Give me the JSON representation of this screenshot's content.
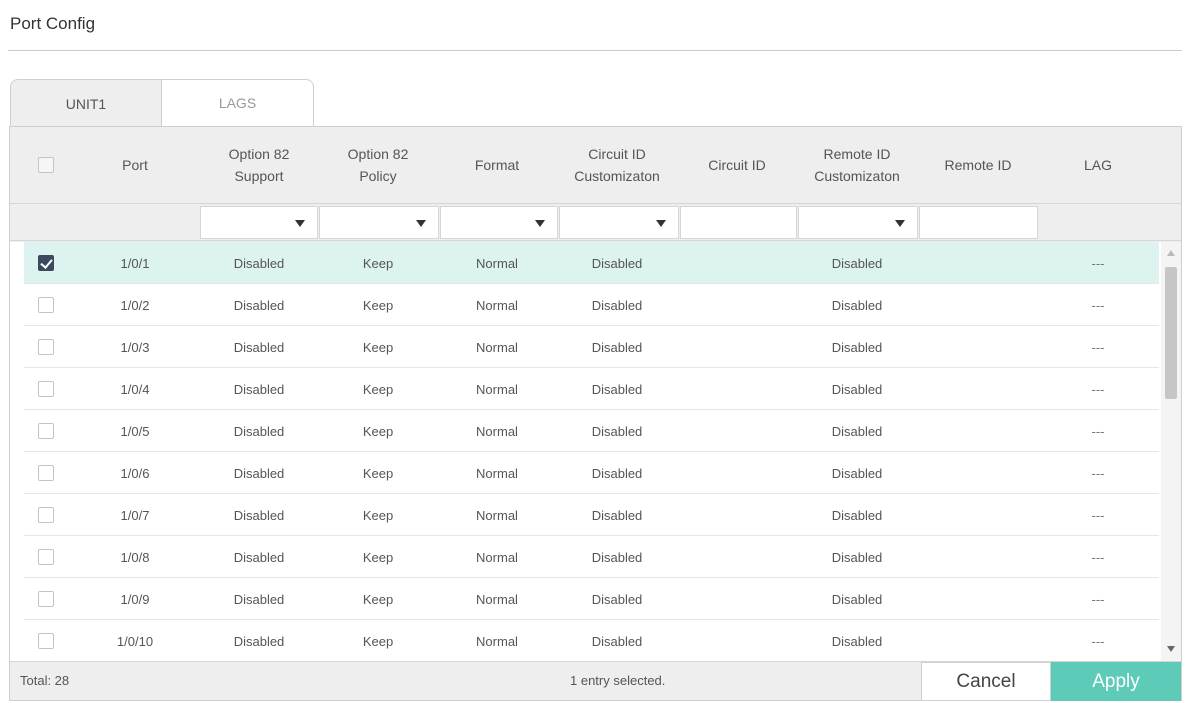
{
  "page": {
    "title": "Port Config"
  },
  "tabs": [
    {
      "label": "UNIT1",
      "active": true
    },
    {
      "label": "LAGS",
      "active": false
    }
  ],
  "columns": {
    "port": "Port",
    "opt82_support": [
      "Option 82",
      "Support"
    ],
    "opt82_policy": [
      "Option 82",
      "Policy"
    ],
    "format": "Format",
    "circuit_custom": [
      "Circuit ID",
      "Customizaton"
    ],
    "circuit_id": "Circuit ID",
    "remote_custom": [
      "Remote ID",
      "Customizaton"
    ],
    "remote_id": "Remote ID",
    "lag": "LAG"
  },
  "rows": [
    {
      "port": "1/0/1",
      "support": "Disabled",
      "policy": "Keep",
      "format": "Normal",
      "circuit_custom": "Disabled",
      "circuit_id": "",
      "remote_custom": "Disabled",
      "remote_id": "",
      "lag": "---",
      "checked": true
    },
    {
      "port": "1/0/2",
      "support": "Disabled",
      "policy": "Keep",
      "format": "Normal",
      "circuit_custom": "Disabled",
      "circuit_id": "",
      "remote_custom": "Disabled",
      "remote_id": "",
      "lag": "---",
      "checked": false
    },
    {
      "port": "1/0/3",
      "support": "Disabled",
      "policy": "Keep",
      "format": "Normal",
      "circuit_custom": "Disabled",
      "circuit_id": "",
      "remote_custom": "Disabled",
      "remote_id": "",
      "lag": "---",
      "checked": false
    },
    {
      "port": "1/0/4",
      "support": "Disabled",
      "policy": "Keep",
      "format": "Normal",
      "circuit_custom": "Disabled",
      "circuit_id": "",
      "remote_custom": "Disabled",
      "remote_id": "",
      "lag": "---",
      "checked": false
    },
    {
      "port": "1/0/5",
      "support": "Disabled",
      "policy": "Keep",
      "format": "Normal",
      "circuit_custom": "Disabled",
      "circuit_id": "",
      "remote_custom": "Disabled",
      "remote_id": "",
      "lag": "---",
      "checked": false
    },
    {
      "port": "1/0/6",
      "support": "Disabled",
      "policy": "Keep",
      "format": "Normal",
      "circuit_custom": "Disabled",
      "circuit_id": "",
      "remote_custom": "Disabled",
      "remote_id": "",
      "lag": "---",
      "checked": false
    },
    {
      "port": "1/0/7",
      "support": "Disabled",
      "policy": "Keep",
      "format": "Normal",
      "circuit_custom": "Disabled",
      "circuit_id": "",
      "remote_custom": "Disabled",
      "remote_id": "",
      "lag": "---",
      "checked": false
    },
    {
      "port": "1/0/8",
      "support": "Disabled",
      "policy": "Keep",
      "format": "Normal",
      "circuit_custom": "Disabled",
      "circuit_id": "",
      "remote_custom": "Disabled",
      "remote_id": "",
      "lag": "---",
      "checked": false
    },
    {
      "port": "1/0/9",
      "support": "Disabled",
      "policy": "Keep",
      "format": "Normal",
      "circuit_custom": "Disabled",
      "circuit_id": "",
      "remote_custom": "Disabled",
      "remote_id": "",
      "lag": "---",
      "checked": false
    },
    {
      "port": "1/0/10",
      "support": "Disabled",
      "policy": "Keep",
      "format": "Normal",
      "circuit_custom": "Disabled",
      "circuit_id": "",
      "remote_custom": "Disabled",
      "remote_id": "",
      "lag": "---",
      "checked": false
    }
  ],
  "footer": {
    "total": "Total: 28",
    "selection": "1 entry selected.",
    "cancel_label": "Cancel",
    "apply_label": "Apply"
  },
  "colors": {
    "accent": "#5dcbb8",
    "selected_row": "#dcf3ef",
    "checkbox_checked": "#3b4a5e"
  }
}
